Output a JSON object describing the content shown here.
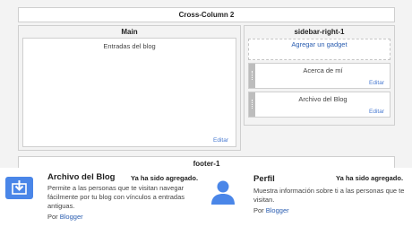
{
  "layout": {
    "cross_column": "Cross-Column 2",
    "main": {
      "title": "Main",
      "inner_label": "Entradas del blog",
      "edit": "Editar"
    },
    "sidebar": {
      "title": "sidebar-right-1",
      "add_gadget": "Agregar un gadget",
      "gadgets": [
        {
          "label": "Acerca de mí",
          "edit": "Editar"
        },
        {
          "label": "Archivo del Blog",
          "edit": "Editar"
        }
      ]
    },
    "footer": "footer-1"
  },
  "gadget_list": [
    {
      "title": "Archivo del Blog",
      "status": "Ya ha sido agregado.",
      "description": "Permite a las personas que te visitan navegar fácilmente por tu blog con vínculos a entradas antiguas.",
      "by_prefix": "Por",
      "by_link": "Blogger",
      "icon": "archive-download-icon"
    },
    {
      "title": "Perfil",
      "status": "Ya ha sido agregado.",
      "description": "Muestra información sobre ti a las personas que te visitan.",
      "by_prefix": "Por",
      "by_link": "Blogger",
      "icon": "person-icon"
    }
  ],
  "colors": {
    "accent": "#4a86e8",
    "link": "#2a5db0"
  }
}
